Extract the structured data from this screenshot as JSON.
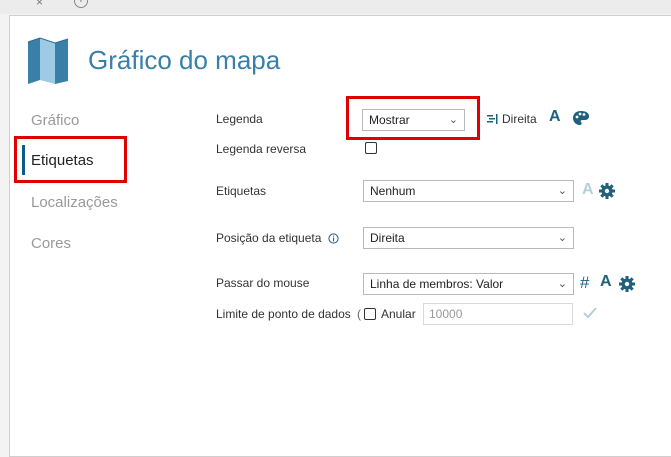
{
  "browser": {
    "close_glyph": "×",
    "new_tab_glyph": "+"
  },
  "header": {
    "title": "Gráfico do mapa"
  },
  "nav": {
    "items": [
      "Gráfico",
      "Etiquetas",
      "Localizações",
      "Cores"
    ],
    "active_index": 1
  },
  "form": {
    "legend": {
      "label": "Legenda",
      "value": "Mostrar",
      "position_label": "Direita",
      "font_glyph": "A"
    },
    "reverse_legend": {
      "label": "Legenda reversa",
      "checked": false
    },
    "labels": {
      "label": "Etiquetas",
      "value": "Nenhum",
      "font_glyph": "A"
    },
    "label_position": {
      "label": "Posição da etiqueta",
      "value": "Direita"
    },
    "hover": {
      "label": "Passar do mouse",
      "value": "Linha de membros: Valor",
      "hash_glyph": "#",
      "font_glyph": "A"
    },
    "data_point_limit": {
      "label": "Limite de ponto de dados",
      "override_glyph": "(",
      "override_label": "Anular",
      "override_checked": false,
      "value": "10000"
    }
  },
  "colors": {
    "accent": "#3a7fa8",
    "icon_dark": "#1f5f7f",
    "active_bar": "#0b5c87",
    "highlight_red": "#e00000"
  }
}
